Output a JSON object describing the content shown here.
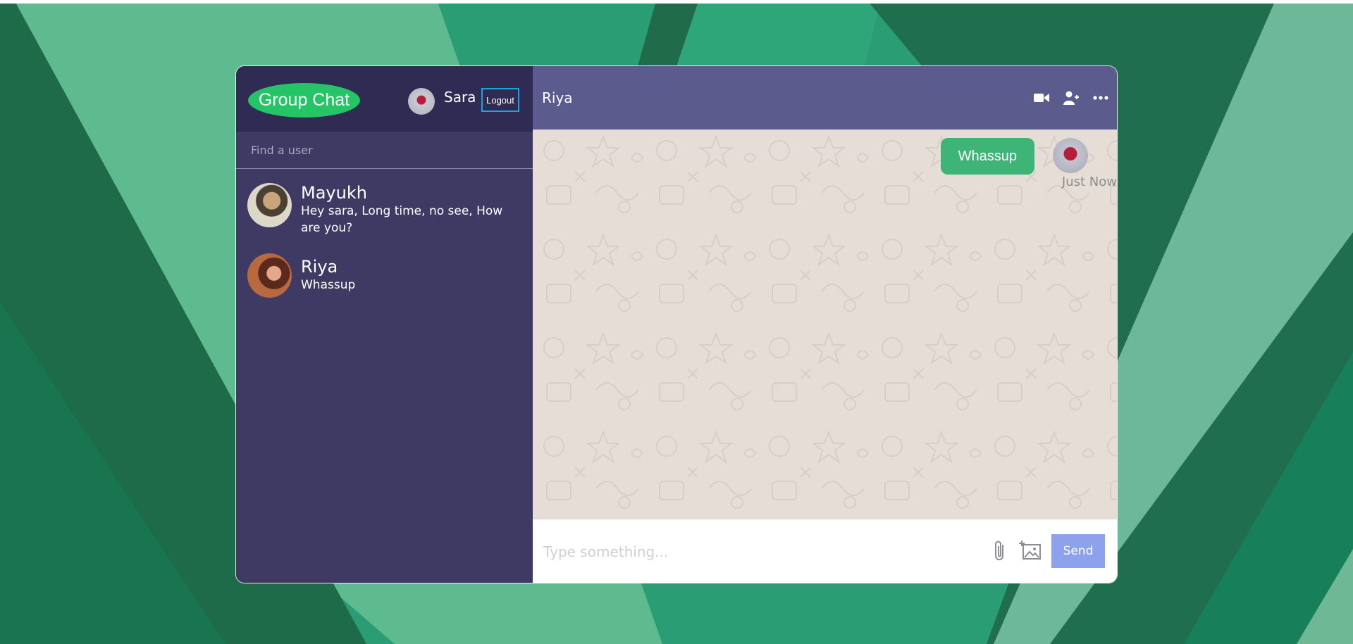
{
  "colors": {
    "sidebar_bg": "#3e3a63",
    "sidebar_header_bg": "#2f2b52",
    "chat_header_bg": "#5c5b8e",
    "brand_green": "#25c466",
    "bubble_green": "#3fb477",
    "send_button": "#8da1ec",
    "logout_border": "#19a6e0",
    "messages_bg": "#e6ddd6"
  },
  "sidebar": {
    "brand": "Group Chat",
    "current_user": "Sara",
    "logout_label": "Logout",
    "search_placeholder": "Find a user",
    "chats": [
      {
        "name": "Mayukh",
        "last_message": "Hey sara, Long time, no see, How are you?"
      },
      {
        "name": "Riya",
        "last_message": "Whassup"
      }
    ]
  },
  "chat": {
    "peer_name": "Riya",
    "header_icons": [
      "video-camera-icon",
      "add-user-icon",
      "more-options-icon"
    ],
    "messages": [
      {
        "text": "Whassup",
        "time": "Just Now"
      }
    ],
    "input_placeholder": "Type something...",
    "send_label": "Send",
    "input_icons": [
      "paperclip-icon",
      "image-upload-icon"
    ]
  }
}
